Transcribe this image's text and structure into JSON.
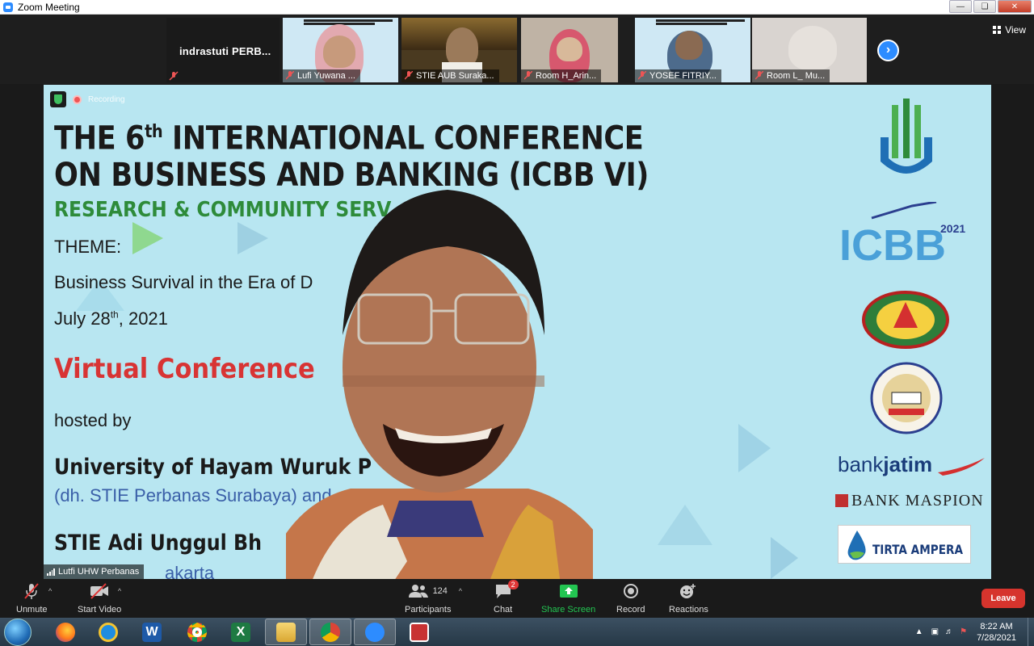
{
  "window": {
    "title": "Zoom Meeting"
  },
  "gallery": {
    "name_tile": "indrastuti  PERB...",
    "thumbnails": [
      {
        "label": "Lufi Yuwana ..."
      },
      {
        "label": "STIE AUB Suraka..."
      },
      {
        "label": "Room H_Arin..."
      },
      {
        "label": "YOSEF FITRIY..."
      },
      {
        "label": "Room L_ Mu..."
      }
    ],
    "view_label": "View"
  },
  "slide": {
    "title_line1": "THE 6",
    "title_sup": "th",
    "title_line1b": " INTERNATIONAL CONFERENCE",
    "title_line2": "ON BUSINESS AND BANKING (ICBB VI)",
    "subtitle": "RESEARCH & COMMUNITY SERV",
    "theme_label": "THEME:",
    "theme_text": "Business Survival in the Era of D",
    "date_main": "July 28",
    "date_sup": "th",
    "date_year": ", 2021",
    "virtual": "Virtual Conference",
    "hosted_by": "hosted by",
    "university": "University of Hayam Wuruk P",
    "dh": "(dh. STIE Perbanas Surabaya) and",
    "stie": "STIE Adi Unggul Bh",
    "bottom_partial": "akarta"
  },
  "logos": {
    "icbb_year": "2021",
    "bankjatim_light": "bank",
    "bankjatim_bold": "jatim",
    "maspion": "BANK MASPION",
    "tirta": "TIRTA AMPERA"
  },
  "recording_label": "Recording",
  "speaker_name": "Lutfi UHW Perbanas",
  "controls": {
    "unmute": "Unmute",
    "start_video": "Start Video",
    "participants": "Participants",
    "participants_count": "124",
    "chat": "Chat",
    "chat_badge": "2",
    "share_screen": "Share Screen",
    "record": "Record",
    "reactions": "Reactions",
    "leave": "Leave"
  },
  "taskbar": {
    "time": "8:22 AM",
    "date": "7/28/2021"
  },
  "colors": {
    "zoom_blue": "#2d8cff",
    "slide_bg": "#b8e6f1",
    "leave_red": "#d6342d",
    "share_green": "#23c552",
    "virtual_red": "#d83434"
  }
}
